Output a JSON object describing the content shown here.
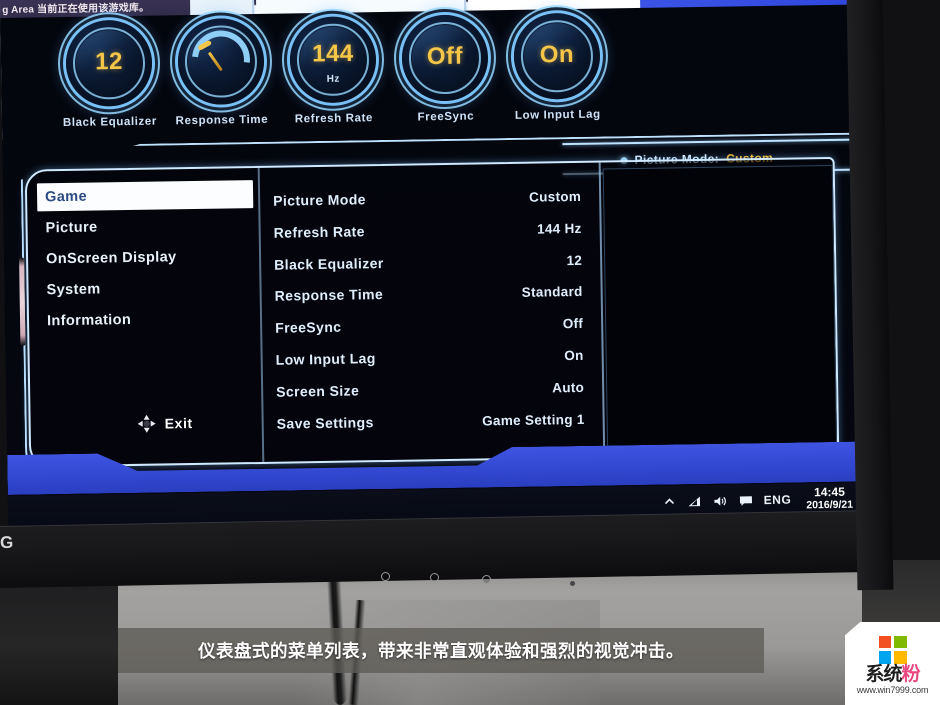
{
  "desktop": {
    "notification_text": "g Area 当前正在使用该游戏库。"
  },
  "dials": [
    {
      "name": "black-equalizer",
      "value": "12",
      "unit": "",
      "label": "Black Equalizer",
      "type": "number"
    },
    {
      "name": "response-time",
      "value": "",
      "unit": "",
      "label": "Response Time",
      "type": "gauge"
    },
    {
      "name": "refresh-rate",
      "value": "144",
      "unit": "Hz",
      "label": "Refresh Rate",
      "type": "number"
    },
    {
      "name": "freesync",
      "value": "Off",
      "unit": "",
      "label": "FreeSync",
      "type": "text"
    },
    {
      "name": "low-input-lag",
      "value": "On",
      "unit": "",
      "label": "Low Input Lag",
      "type": "text"
    }
  ],
  "status_strip": {
    "label": "Picture Mode:",
    "value": "Custom"
  },
  "menu": {
    "items": [
      {
        "label": "Game",
        "selected": true
      },
      {
        "label": "Picture",
        "selected": false
      },
      {
        "label": "OnScreen Display",
        "selected": false
      },
      {
        "label": "System",
        "selected": false
      },
      {
        "label": "Information",
        "selected": false
      }
    ],
    "exit_label": "Exit",
    "exit_icon": "dpad-icon"
  },
  "settings": {
    "rows": [
      {
        "name": "Picture Mode",
        "value": "Custom"
      },
      {
        "name": "Refresh Rate",
        "value": "144 Hz"
      },
      {
        "name": "Black Equalizer",
        "value": "12"
      },
      {
        "name": "Response Time",
        "value": "Standard"
      },
      {
        "name": "FreeSync",
        "value": "Off"
      },
      {
        "name": "Low Input Lag",
        "value": "On"
      },
      {
        "name": "Screen Size",
        "value": "Auto"
      },
      {
        "name": "Save Settings",
        "value": "Game Setting 1"
      }
    ]
  },
  "taskbar": {
    "icons": [
      "chevron-up-icon",
      "wifi-icon",
      "volume-icon",
      "notification-icon"
    ],
    "language": "ENG",
    "time": "14:45",
    "date": "2016/9/21"
  },
  "monitor": {
    "brand_fragment": "G",
    "button_count": 3
  },
  "caption": {
    "text": "仪表盘式的菜单列表，带来非常直观体验和强烈的视觉冲击。"
  },
  "watermark": {
    "name_left": "系统",
    "name_right": "粉",
    "url": "www.win7999.com"
  },
  "colors": {
    "accent_gold": "#f6c648",
    "accent_blue": "#bfe2ff",
    "band_blue": "#3f55e2",
    "status_value": "#f6b426"
  }
}
